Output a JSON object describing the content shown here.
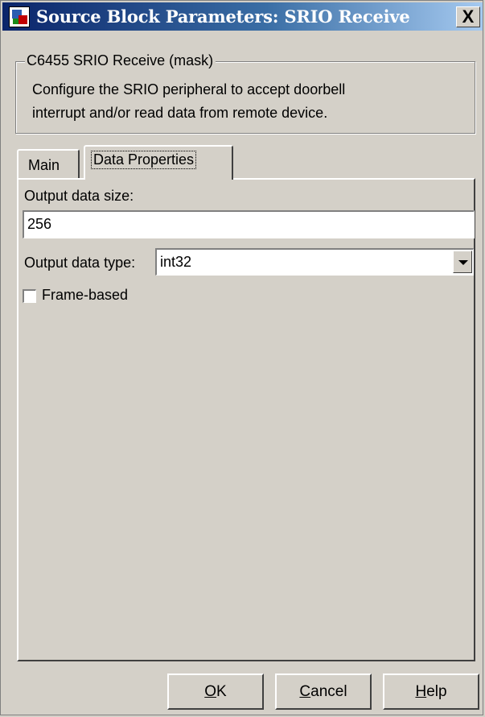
{
  "window": {
    "title": "Source Block Parameters: SRIO Receive",
    "close_label": "X"
  },
  "group": {
    "legend": "C6455 SRIO Receive (mask)",
    "description_line1": "Configure the SRIO peripheral to accept doorbell",
    "description_line2": "interrupt and/or read data from remote device."
  },
  "tabs": [
    {
      "label": "Main",
      "selected": false
    },
    {
      "label": "Data Properties",
      "selected": true
    }
  ],
  "fields": {
    "output_size_label": "Output data size:",
    "output_size_value": "256",
    "output_type_label": "Output data type:",
    "output_type_value": "int32",
    "frame_based_label": "Frame-based",
    "frame_based_checked": false
  },
  "buttons": {
    "ok": {
      "accel": "O",
      "rest": "K"
    },
    "cancel": {
      "accel": "C",
      "rest": "ancel"
    },
    "help": {
      "accel": "H",
      "rest": "elp"
    }
  },
  "icons": [
    "simulink-block-icon",
    "close-icon",
    "dropdown-arrow-icon",
    "checkbox-icon"
  ]
}
